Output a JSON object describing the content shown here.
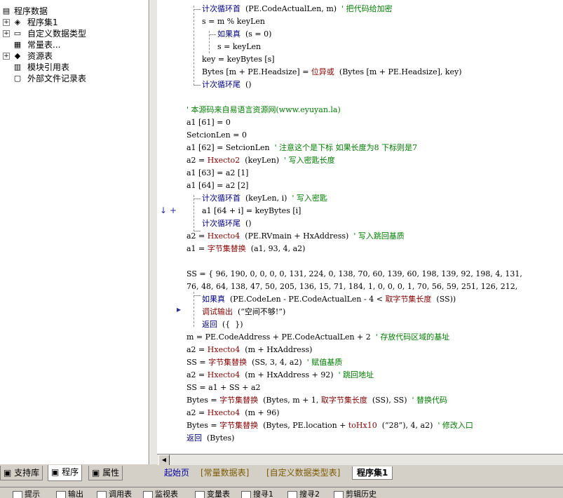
{
  "tree": [
    {
      "label": "程序数据",
      "expander": "",
      "icon": "db-icon"
    },
    {
      "label": "程序集1",
      "expander": "+",
      "icon": "layers-icon"
    },
    {
      "label": "自定义数据类型",
      "expander": "+",
      "icon": "doc-icon"
    },
    {
      "label": "常量表...",
      "expander": "",
      "icon": "table-icon"
    },
    {
      "label": "资源表",
      "expander": "+",
      "icon": "resource-icon"
    },
    {
      "label": "模块引用表",
      "expander": "",
      "icon": "module-icon"
    },
    {
      "label": "外部文件记录表",
      "expander": "",
      "icon": "file-icon"
    }
  ],
  "left_tabs": [
    "支持库",
    "程序",
    "属性"
  ],
  "code_lines": [
    {
      "i": 1,
      "parts": [
        [
          "kw",
          "计次循环首"
        ],
        [
          "",
          "  (PE.CodeActualLen, m)  "
        ],
        [
          "cm",
          "' 把代码给加密"
        ]
      ]
    },
    {
      "i": 1,
      "parts": [
        [
          "",
          "s = m % keyLen"
        ]
      ]
    },
    {
      "i": 2,
      "parts": [
        [
          "kw",
          "如果真"
        ],
        [
          "",
          "  (s = 0)"
        ]
      ]
    },
    {
      "i": 2,
      "parts": [
        [
          "",
          "s = keyLen"
        ]
      ]
    },
    {
      "i": 1,
      "parts": [
        [
          "",
          "key = keyBytes [s]"
        ]
      ]
    },
    {
      "i": 1,
      "parts": [
        [
          "",
          "Bytes [m + PE.Headsize] = "
        ],
        [
          "fn",
          "位异或"
        ],
        [
          "",
          "  (Bytes [m + PE.Headsize], key)"
        ]
      ]
    },
    {
      "i": 1,
      "parts": [
        [
          "kw",
          "计次循环尾"
        ],
        [
          "",
          "  ()"
        ]
      ]
    },
    {
      "i": 0,
      "parts": [
        [
          "",
          ""
        ]
      ]
    },
    {
      "i": 0,
      "parts": [
        [
          "cm",
          "' 本源码来自易语言资源网(www.eyuyan.la)"
        ]
      ]
    },
    {
      "i": 0,
      "parts": [
        [
          "",
          "a1 [61] = 0"
        ]
      ]
    },
    {
      "i": 0,
      "parts": [
        [
          "",
          "SetcionLen = 0"
        ]
      ]
    },
    {
      "i": 0,
      "parts": [
        [
          "",
          "a1 [62] = SetcionLen  "
        ],
        [
          "cm",
          "' 注意这个是下标 如果长度为8 下标则是7"
        ]
      ]
    },
    {
      "i": 0,
      "parts": [
        [
          "",
          "a2 = "
        ],
        [
          "fn",
          "Hxecto2"
        ],
        [
          "",
          "  (keyLen)  "
        ],
        [
          "cm",
          "' 写入密匙长度"
        ]
      ]
    },
    {
      "i": 0,
      "parts": [
        [
          "",
          "a1 [63] = a2 [1]"
        ]
      ]
    },
    {
      "i": 0,
      "parts": [
        [
          "",
          "a1 [64] = a2 [2]"
        ]
      ]
    },
    {
      "i": 1,
      "parts": [
        [
          "kw",
          "计次循环首"
        ],
        [
          "",
          "  (keyLen, i)  "
        ],
        [
          "cm",
          "' 写入密匙"
        ]
      ]
    },
    {
      "i": 1,
      "parts": [
        [
          "",
          "a1 [64 + i] = keyBytes [i]"
        ]
      ]
    },
    {
      "i": 1,
      "parts": [
        [
          "kw",
          "计次循环尾"
        ],
        [
          "",
          "  ()"
        ]
      ]
    },
    {
      "i": 0,
      "parts": [
        [
          "",
          "a2 = "
        ],
        [
          "fn",
          "Hxecto4"
        ],
        [
          "",
          "  (PE.RVmain + HxAddress)  "
        ],
        [
          "cm",
          "' 写入跳回基质"
        ]
      ]
    },
    {
      "i": 0,
      "parts": [
        [
          "",
          "a1 = "
        ],
        [
          "fn",
          "字节集替换"
        ],
        [
          "",
          "  (a1, 93, 4, a2)"
        ]
      ]
    },
    {
      "i": 0,
      "parts": [
        [
          "",
          ""
        ]
      ]
    },
    {
      "i": 0,
      "parts": [
        [
          "",
          "SS = { 96, 190, 0, 0, 0, 0, 131, 224, 0, 138, 70, 60, 139, 60, 198, 139, 92, 198, 4, 131,"
        ]
      ]
    },
    {
      "i": 0,
      "parts": [
        [
          "",
          "76, 48, 64, 138, 47, 50, 205, 136, 15, 71, 184, 1, 0, 0, 0, 1, 70, 56, 59, 251, 126, 212,"
        ]
      ]
    },
    {
      "i": 1,
      "parts": [
        [
          "kw",
          "如果真"
        ],
        [
          "",
          "  (PE.CodeLen - PE.CodeActualLen - 4 < "
        ],
        [
          "fn",
          "取字节集长度"
        ],
        [
          "",
          "  (SS))"
        ]
      ]
    },
    {
      "i": 1,
      "parts": [
        [
          "fn",
          "调试输出"
        ],
        [
          "",
          "  (“空间不够!”)"
        ]
      ]
    },
    {
      "i": 1,
      "parts": [
        [
          "kw",
          "返回"
        ],
        [
          "",
          "  ({  })"
        ]
      ]
    },
    {
      "i": 0,
      "parts": [
        [
          "",
          "m = PE.CodeAddress + PE.CodeActualLen + 2  "
        ],
        [
          "cm",
          "' 存放代码区域的基址"
        ]
      ]
    },
    {
      "i": 0,
      "parts": [
        [
          "",
          "a2 = "
        ],
        [
          "fn",
          "Hxecto4"
        ],
        [
          "",
          "  (m + HxAddress)"
        ]
      ]
    },
    {
      "i": 0,
      "parts": [
        [
          "",
          "SS = "
        ],
        [
          "fn",
          "字节集替换"
        ],
        [
          "",
          "  (SS, 3, 4, a2)  "
        ],
        [
          "cm",
          "' 赋值基质"
        ]
      ]
    },
    {
      "i": 0,
      "parts": [
        [
          "",
          "a2 = "
        ],
        [
          "fn",
          "Hxecto4"
        ],
        [
          "",
          "  (m + HxAddress + 92)  "
        ],
        [
          "cm",
          "' 跳回地址"
        ]
      ]
    },
    {
      "i": 0,
      "parts": [
        [
          "",
          "SS = a1 + SS + a2"
        ]
      ]
    },
    {
      "i": 0,
      "parts": [
        [
          "",
          "Bytes = "
        ],
        [
          "fn",
          "字节集替换"
        ],
        [
          "",
          "  (Bytes, m + 1, "
        ],
        [
          "fn",
          "取字节集长度"
        ],
        [
          "",
          "  (SS), SS)  "
        ],
        [
          "cm",
          "' 替换代码"
        ]
      ]
    },
    {
      "i": 0,
      "parts": [
        [
          "",
          "a2 = "
        ],
        [
          "fn",
          "Hxecto4"
        ],
        [
          "",
          "  (m + 96)"
        ]
      ]
    },
    {
      "i": 0,
      "parts": [
        [
          "",
          "Bytes = "
        ],
        [
          "fn",
          "字节集替换"
        ],
        [
          "",
          "  (Bytes, PE.location + "
        ],
        [
          "fn",
          "toHx10"
        ],
        [
          "",
          "  (“28”), 4, a2)  "
        ],
        [
          "cm",
          "' 修改入口"
        ]
      ]
    },
    {
      "i": 0,
      "parts": [
        [
          "kw",
          "返回"
        ],
        [
          "",
          "  (Bytes)"
        ]
      ]
    }
  ],
  "gutter_marks": {
    "arrow": "↓",
    "plus": "+",
    "breakpoint": "▸▸"
  },
  "doc_tabs": [
    "起始页",
    "[常量数据表]",
    "[自定义数据类型表]",
    "程序集1"
  ],
  "bottom_bar": [
    "提示",
    "输出",
    "调用表",
    "监视表",
    "变量表",
    "搜寻1",
    "搜寻2",
    "剪辑历史"
  ]
}
